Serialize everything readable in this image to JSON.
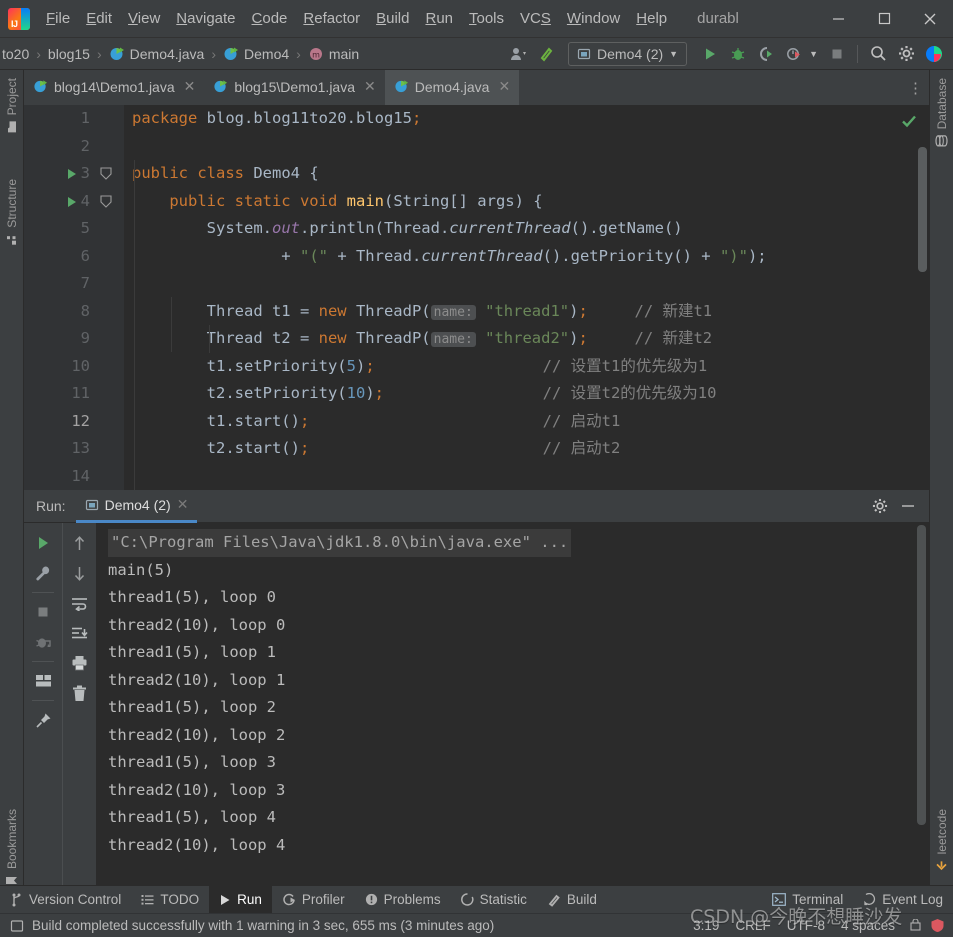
{
  "window": {
    "app_icon": "intellij-idea-logo",
    "title": "durabl",
    "minimize_label": "—",
    "maximize_label": "☐",
    "close_label": "✕"
  },
  "menubar": {
    "items": [
      {
        "label": "File",
        "mnemonic": "F"
      },
      {
        "label": "Edit",
        "mnemonic": "E"
      },
      {
        "label": "View",
        "mnemonic": "V"
      },
      {
        "label": "Navigate",
        "mnemonic": "N"
      },
      {
        "label": "Code",
        "mnemonic": "C"
      },
      {
        "label": "Refactor",
        "mnemonic": "R"
      },
      {
        "label": "Build",
        "mnemonic": "B"
      },
      {
        "label": "Run",
        "mnemonic": "R"
      },
      {
        "label": "Tools",
        "mnemonic": "T"
      },
      {
        "label": "VCS",
        "mnemonic": "S"
      },
      {
        "label": "Window",
        "mnemonic": "W"
      },
      {
        "label": "Help",
        "mnemonic": "H"
      }
    ]
  },
  "navbar": {
    "breadcrumbs": [
      {
        "label": "to20",
        "icon": "none"
      },
      {
        "label": "blog15",
        "icon": "none"
      },
      {
        "label": "Demo4.java",
        "icon": "java-class-icon"
      },
      {
        "label": "Demo4",
        "icon": "java-class-icon"
      },
      {
        "label": "main",
        "icon": "method-icon"
      }
    ],
    "separator": "›",
    "run_config": {
      "label": "Demo4 (2)",
      "icon": "run-config-icon",
      "chevron": "▼"
    },
    "actions": [
      {
        "name": "user-icon",
        "label": ""
      },
      {
        "name": "build-hammer-icon",
        "label": ""
      },
      {
        "name": "run-button",
        "label": ""
      },
      {
        "name": "debug-button",
        "label": ""
      },
      {
        "name": "run-coverage-button",
        "label": ""
      },
      {
        "name": "profiler-button",
        "label": ""
      },
      {
        "name": "stop-button",
        "label": ""
      },
      {
        "name": "search-everywhere-icon",
        "label": ""
      },
      {
        "name": "settings-gear-icon",
        "label": ""
      },
      {
        "name": "ide-help-icon",
        "label": ""
      }
    ]
  },
  "left_tool_strip": {
    "top_items": [
      {
        "label": "Project",
        "icon": "project-folder-icon"
      },
      {
        "label": "Structure",
        "icon": "structure-icon"
      }
    ],
    "bottom_items": [
      {
        "label": "Bookmarks",
        "icon": "bookmark-icon"
      }
    ]
  },
  "right_tool_strip": {
    "top_items": [
      {
        "label": "Database",
        "icon": "database-icon"
      }
    ],
    "bottom_items": [
      {
        "label": "leetcode",
        "icon": "leetcode-icon"
      }
    ]
  },
  "editor": {
    "tabs": [
      {
        "label": "blog14\\Demo1.java",
        "icon": "java-class-icon",
        "active": false,
        "close": "✕"
      },
      {
        "label": "blog15\\Demo1.java",
        "icon": "java-class-icon",
        "active": false,
        "close": "✕"
      },
      {
        "label": "Demo4.java",
        "icon": "java-class-icon",
        "active": true,
        "close": "✕"
      }
    ],
    "tab_options_icon": "more-options-icon",
    "inspection_status_icon": "inspections-ok-check-icon",
    "current_line": 12,
    "line_numbers": [
      "1",
      "2",
      "3",
      "4",
      "5",
      "6",
      "7",
      "8",
      "9",
      "10",
      "11",
      "12",
      "13",
      "14"
    ],
    "code_lines": [
      "package blog.blog11to20.blog15;",
      "",
      "public class Demo4 {",
      "    public static void main(String[] args) {",
      "        System.out.println(Thread.currentThread().getName()",
      "                + \"(\" + Thread.currentThread().getPriority() + \")\");",
      "",
      "        Thread t1 = new ThreadP( name: \"thread1\");     // 新建t1",
      "        Thread t2 = new ThreadP( name: \"thread2\");     // 新建t2",
      "        t1.setPriority(5);                  // 设置t1的优先级为1",
      "        t2.setPriority(10);                 // 设置t2的优先级为10",
      "        t1.start();                         // 启动t1",
      "        t2.start();                         // 启动t2",
      ""
    ],
    "gutter_markers": [
      {
        "line": 3,
        "icon": "run-gutter-icon"
      },
      {
        "line": 4,
        "icon": "run-gutter-icon"
      },
      {
        "line": 12,
        "icon": "intention-bulb-icon"
      }
    ]
  },
  "run_panel": {
    "title": "Run:",
    "tab": {
      "label": "Demo4 (2)",
      "icon": "run-config-icon",
      "close": "✕"
    },
    "header_actions": [
      {
        "name": "settings-gear-icon"
      },
      {
        "name": "hide-panel-icon"
      }
    ],
    "left_toolbar": [
      {
        "name": "rerun-button",
        "icon": "green-play-icon"
      },
      {
        "name": "edit-configurations-button",
        "icon": "wrench-icon"
      },
      {
        "name": "stop-button",
        "icon": "stop-square-icon"
      },
      {
        "name": "dump-threads-button",
        "icon": "camera-bug-icon"
      },
      {
        "name": "restore-layout-button",
        "icon": "layout-icon"
      },
      {
        "name": "pin-tab-button",
        "icon": "pin-icon"
      }
    ],
    "right_toolbar": [
      {
        "name": "previous-occurrence-button",
        "icon": "arrow-up-icon"
      },
      {
        "name": "next-occurrence-button",
        "icon": "arrow-down-icon"
      },
      {
        "name": "soft-wrap-button",
        "icon": "soft-wrap-icon"
      },
      {
        "name": "scroll-to-end-button",
        "icon": "scroll-end-icon"
      },
      {
        "name": "print-button",
        "icon": "printer-icon"
      },
      {
        "name": "clear-all-button",
        "icon": "trash-icon"
      }
    ],
    "console_lines": [
      {
        "text": "\"C:\\Program Files\\Java\\jdk1.8.0\\bin\\java.exe\" ...",
        "style": "command"
      },
      {
        "text": "main(5)",
        "style": "normal"
      },
      {
        "text": "thread1(5), loop 0",
        "style": "normal"
      },
      {
        "text": "thread2(10), loop 0",
        "style": "normal"
      },
      {
        "text": "thread1(5), loop 1",
        "style": "normal"
      },
      {
        "text": "thread2(10), loop 1",
        "style": "normal"
      },
      {
        "text": "thread1(5), loop 2",
        "style": "normal"
      },
      {
        "text": "thread2(10), loop 2",
        "style": "normal"
      },
      {
        "text": "thread1(5), loop 3",
        "style": "normal"
      },
      {
        "text": "thread2(10), loop 3",
        "style": "normal"
      },
      {
        "text": "thread1(5), loop 4",
        "style": "normal"
      },
      {
        "text": "thread2(10), loop 4",
        "style": "normal"
      }
    ]
  },
  "tool_window_bar": {
    "left_items": [
      {
        "label": "Version Control",
        "icon": "vcs-branch-icon",
        "active": false
      },
      {
        "label": "TODO",
        "icon": "todo-list-icon",
        "active": false
      },
      {
        "label": "Run",
        "icon": "run-play-icon",
        "active": true
      },
      {
        "label": "Profiler",
        "icon": "profiler-icon",
        "active": false
      },
      {
        "label": "Problems",
        "icon": "problems-icon",
        "active": false
      },
      {
        "label": "Statistic",
        "icon": "statistic-icon",
        "active": false
      },
      {
        "label": "Build",
        "icon": "build-hammer-icon",
        "active": false
      }
    ],
    "right_items": [
      {
        "label": "Terminal",
        "icon": "terminal-icon",
        "active": false
      },
      {
        "label": "Event Log",
        "icon": "event-log-icon",
        "active": false
      }
    ]
  },
  "status_bar": {
    "icon": "status-message-icon",
    "message": "Build completed successfully with 1 warning in 3 sec, 655 ms (3 minutes ago)",
    "caret_position": "3:19",
    "line_separator": "CRLF",
    "encoding": "UTF-8",
    "indent": "4 spaces",
    "lock_icon": "read-only-lock-icon",
    "inspection_icon": "inspection-profile-icon"
  },
  "watermark": {
    "text": "CSDN @今晚不想睡沙发"
  },
  "colors": {
    "chrome_bg": "#3c3f41",
    "editor_bg": "#2b2b2b",
    "gutter_bg": "#313335",
    "accent_blue": "#4a88c7",
    "keyword_orange": "#cc7832",
    "string_green": "#6a8759",
    "number_blue": "#6897bb",
    "comment_gray": "#808080",
    "method_yellow": "#ffc66d",
    "static_purple": "#9876aa",
    "text_default": "#a9b7c6",
    "green_run": "#59a869"
  }
}
